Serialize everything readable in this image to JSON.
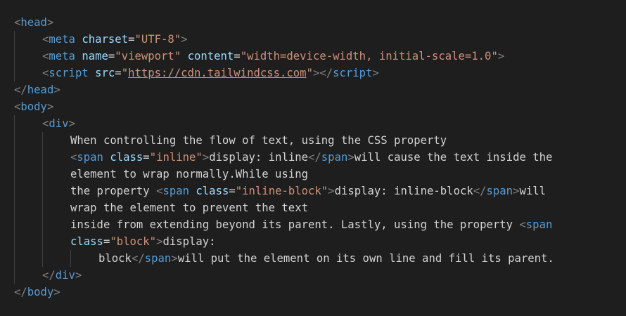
{
  "editor": {
    "lines": [
      {
        "indent": 0,
        "tokens": [
          {
            "t": "<",
            "c": "bracket"
          },
          {
            "t": "head",
            "c": "tag"
          },
          {
            "t": ">",
            "c": "bracket"
          }
        ]
      },
      {
        "indent": 1,
        "tokens": [
          {
            "t": "<",
            "c": "bracket"
          },
          {
            "t": "meta",
            "c": "tag"
          },
          {
            "t": " "
          },
          {
            "t": "charset",
            "c": "attr"
          },
          {
            "t": "=",
            "c": "eq"
          },
          {
            "t": "\"UTF-8\"",
            "c": "str"
          },
          {
            "t": ">",
            "c": "bracket"
          }
        ]
      },
      {
        "indent": 1,
        "tokens": [
          {
            "t": "<",
            "c": "bracket"
          },
          {
            "t": "meta",
            "c": "tag"
          },
          {
            "t": " "
          },
          {
            "t": "name",
            "c": "attr"
          },
          {
            "t": "=",
            "c": "eq"
          },
          {
            "t": "\"viewport\"",
            "c": "str"
          },
          {
            "t": " "
          },
          {
            "t": "content",
            "c": "attr"
          },
          {
            "t": "=",
            "c": "eq"
          },
          {
            "t": "\"width=device-width, initial-scale=1.0\"",
            "c": "str"
          },
          {
            "t": ">",
            "c": "bracket"
          }
        ]
      },
      {
        "indent": 1,
        "tokens": [
          {
            "t": "<",
            "c": "bracket"
          },
          {
            "t": "script",
            "c": "tag"
          },
          {
            "t": " "
          },
          {
            "t": "src",
            "c": "attr"
          },
          {
            "t": "=",
            "c": "eq"
          },
          {
            "t": "\"",
            "c": "str"
          },
          {
            "t": "https://cdn.tailwindcss.com",
            "c": "url"
          },
          {
            "t": "\"",
            "c": "str"
          },
          {
            "t": "></",
            "c": "bracket"
          },
          {
            "t": "script",
            "c": "tag"
          },
          {
            "t": ">",
            "c": "bracket"
          }
        ]
      },
      {
        "indent": 0,
        "tokens": [
          {
            "t": "</",
            "c": "bracket"
          },
          {
            "t": "head",
            "c": "tag"
          },
          {
            "t": ">",
            "c": "bracket"
          }
        ]
      },
      {
        "indent": 0,
        "tokens": [
          {
            "t": "<",
            "c": "bracket"
          },
          {
            "t": "body",
            "c": "tag"
          },
          {
            "t": ">",
            "c": "bracket"
          }
        ]
      },
      {
        "indent": 1,
        "tokens": [
          {
            "t": "<",
            "c": "bracket"
          },
          {
            "t": "div",
            "c": "tag"
          },
          {
            "t": ">",
            "c": "bracket"
          }
        ]
      },
      {
        "indent": 2,
        "tokens": [
          {
            "t": "When controlling the flow of text, using the CSS property",
            "c": "txt"
          }
        ]
      },
      {
        "indent": 2,
        "tokens": [
          {
            "t": "<",
            "c": "bracket"
          },
          {
            "t": "span",
            "c": "tag"
          },
          {
            "t": " "
          },
          {
            "t": "class",
            "c": "attr"
          },
          {
            "t": "=",
            "c": "eq"
          },
          {
            "t": "\"inline\"",
            "c": "str"
          },
          {
            "t": ">",
            "c": "bracket"
          },
          {
            "t": "display: inline",
            "c": "txt"
          },
          {
            "t": "</",
            "c": "bracket"
          },
          {
            "t": "span",
            "c": "tag"
          },
          {
            "t": ">",
            "c": "bracket"
          },
          {
            "t": "will cause the text inside the",
            "c": "txt"
          }
        ]
      },
      {
        "indent": 2,
        "tokens": [
          {
            "t": "element to wrap normally.While using",
            "c": "txt"
          }
        ]
      },
      {
        "indent": 2,
        "tokens": [
          {
            "t": "the property ",
            "c": "txt"
          },
          {
            "t": "<",
            "c": "bracket"
          },
          {
            "t": "span",
            "c": "tag"
          },
          {
            "t": " "
          },
          {
            "t": "class",
            "c": "attr"
          },
          {
            "t": "=",
            "c": "eq"
          },
          {
            "t": "\"inline-block\"",
            "c": "str"
          },
          {
            "t": ">",
            "c": "bracket"
          },
          {
            "t": "display: inline-block",
            "c": "txt"
          },
          {
            "t": "</",
            "c": "bracket"
          },
          {
            "t": "span",
            "c": "tag"
          },
          {
            "t": ">",
            "c": "bracket"
          },
          {
            "t": "will",
            "c": "txt"
          }
        ]
      },
      {
        "indent": 2,
        "tokens": [
          {
            "t": "wrap the element to prevent the text",
            "c": "txt"
          }
        ]
      },
      {
        "indent": 2,
        "tokens": [
          {
            "t": "inside from extending beyond its parent. Lastly, using the property ",
            "c": "txt"
          },
          {
            "t": "<",
            "c": "bracket"
          },
          {
            "t": "span",
            "c": "tag"
          }
        ]
      },
      {
        "indent": 2,
        "tokens": [
          {
            "t": "class",
            "c": "attr"
          },
          {
            "t": "=",
            "c": "eq"
          },
          {
            "t": "\"block\"",
            "c": "str"
          },
          {
            "t": ">",
            "c": "bracket"
          },
          {
            "t": "display:",
            "c": "txt"
          }
        ]
      },
      {
        "indent": 3,
        "tokens": [
          {
            "t": "block",
            "c": "txt"
          },
          {
            "t": "</",
            "c": "bracket"
          },
          {
            "t": "span",
            "c": "tag"
          },
          {
            "t": ">",
            "c": "bracket"
          },
          {
            "t": "will put the element on its own line and fill its parent.",
            "c": "txt"
          }
        ]
      },
      {
        "indent": 1,
        "tokens": [
          {
            "t": "</",
            "c": "bracket"
          },
          {
            "t": "div",
            "c": "tag"
          },
          {
            "t": ">",
            "c": "bracket"
          }
        ]
      },
      {
        "indent": 0,
        "tokens": [
          {
            "t": "</",
            "c": "bracket"
          },
          {
            "t": "body",
            "c": "tag"
          },
          {
            "t": ">",
            "c": "bracket"
          }
        ]
      }
    ]
  },
  "colors": {
    "background": "#1e1e1e",
    "tag": "#569cd6",
    "attribute": "#9cdcfe",
    "string": "#ce9178",
    "text": "#d4d4d4",
    "bracket": "#808080",
    "indent_guide": "#404040"
  }
}
